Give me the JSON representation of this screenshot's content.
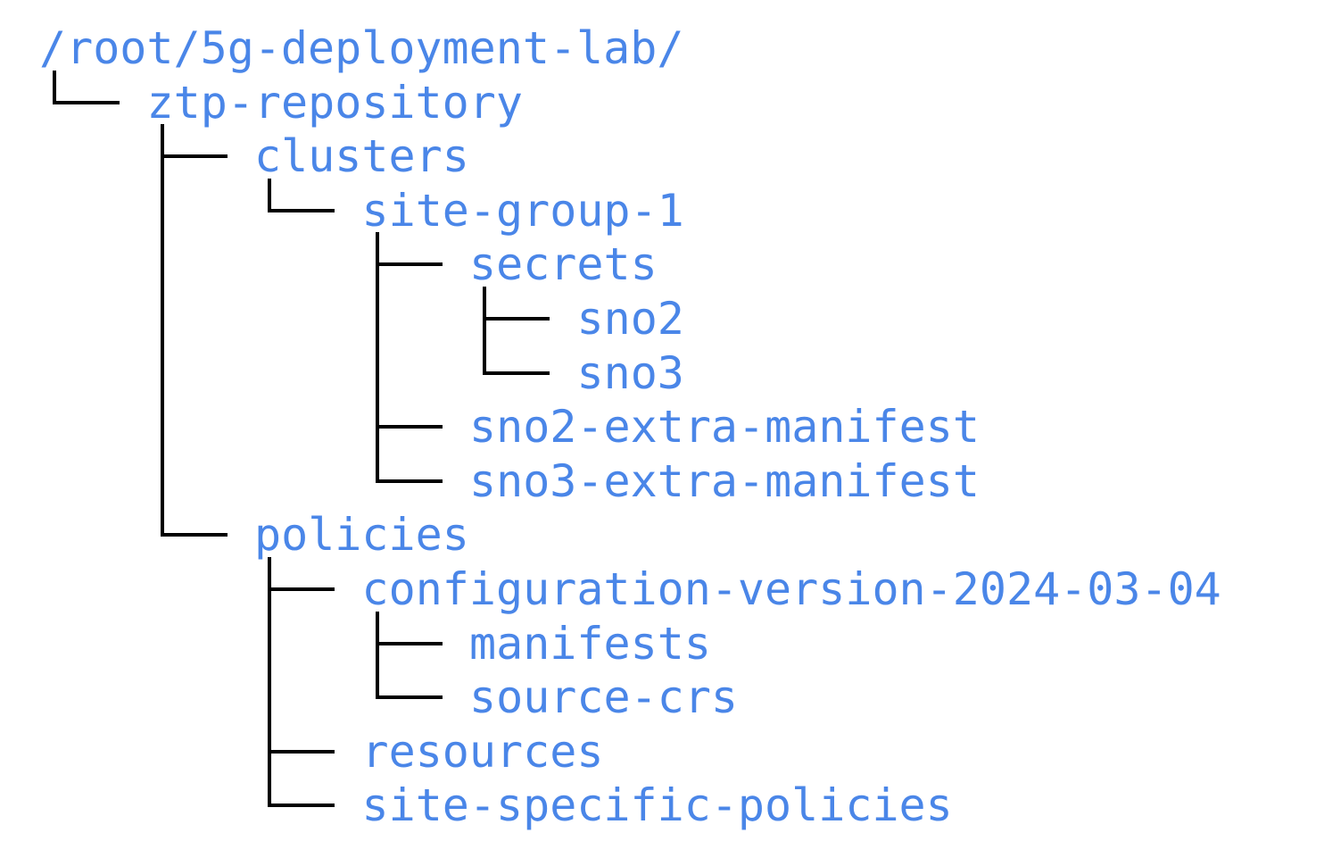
{
  "tree": {
    "colors": {
      "label": "#4a86e8",
      "line": "#000000"
    },
    "nodes": [
      {
        "id": "root",
        "name": "/root/5g-deployment-lab/",
        "depth": 0,
        "parent": null
      },
      {
        "id": "ztp-repository",
        "name": "ztp-repository",
        "depth": 1,
        "parent": "root"
      },
      {
        "id": "clusters",
        "name": "clusters",
        "depth": 2,
        "parent": "ztp-repository"
      },
      {
        "id": "site-group-1",
        "name": "site-group-1",
        "depth": 3,
        "parent": "clusters"
      },
      {
        "id": "secrets",
        "name": "secrets",
        "depth": 4,
        "parent": "site-group-1"
      },
      {
        "id": "sno2",
        "name": "sno2",
        "depth": 5,
        "parent": "secrets"
      },
      {
        "id": "sno3",
        "name": "sno3",
        "depth": 5,
        "parent": "secrets"
      },
      {
        "id": "sno2-extra-manifest",
        "name": "sno2-extra-manifest",
        "depth": 4,
        "parent": "site-group-1"
      },
      {
        "id": "sno3-extra-manifest",
        "name": "sno3-extra-manifest",
        "depth": 4,
        "parent": "site-group-1"
      },
      {
        "id": "policies",
        "name": "policies",
        "depth": 2,
        "parent": "ztp-repository"
      },
      {
        "id": "configuration-version-2024-03-04",
        "name": "configuration-version-2024-03-04",
        "depth": 3,
        "parent": "policies"
      },
      {
        "id": "manifests",
        "name": "manifests",
        "depth": 4,
        "parent": "configuration-version-2024-03-04"
      },
      {
        "id": "source-crs",
        "name": "source-crs",
        "depth": 4,
        "parent": "configuration-version-2024-03-04"
      },
      {
        "id": "resources",
        "name": "resources",
        "depth": 3,
        "parent": "policies"
      },
      {
        "id": "site-specific-policies",
        "name": "site-specific-policies",
        "depth": 3,
        "parent": "policies"
      }
    ]
  }
}
